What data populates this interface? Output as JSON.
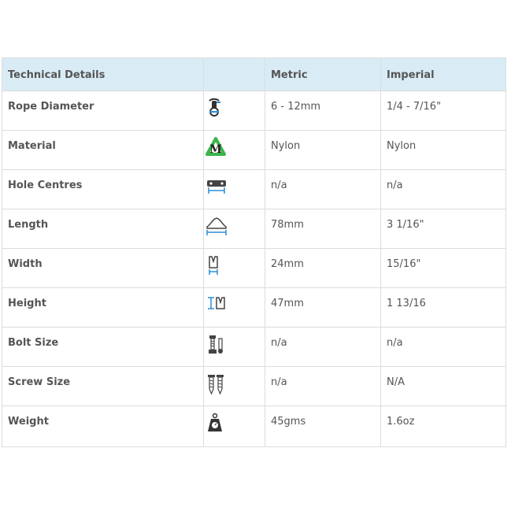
{
  "table": {
    "headers": [
      "Technical Details",
      "",
      "Metric",
      "Imperial"
    ],
    "rows": [
      {
        "label": "Rope Diameter",
        "icon": "rope-diameter-icon",
        "metric": "6 - 12mm",
        "imperial": "1/4 - 7/16\""
      },
      {
        "label": "Material",
        "icon": "nylon-recycle-icon",
        "metric": "Nylon",
        "imperial": "Nylon"
      },
      {
        "label": "Hole Centres",
        "icon": "hole-centres-icon",
        "metric": "n/a",
        "imperial": "n/a"
      },
      {
        "label": "Length",
        "icon": "length-icon",
        "metric": "78mm",
        "imperial": "3 1/16\""
      },
      {
        "label": "Width",
        "icon": "width-icon",
        "metric": "24mm",
        "imperial": "15/16\""
      },
      {
        "label": "Height",
        "icon": "height-icon",
        "metric": "47mm",
        "imperial": "1 13/16"
      },
      {
        "label": "Bolt Size",
        "icon": "bolt-icon",
        "metric": "n/a",
        "imperial": "n/a"
      },
      {
        "label": "Screw Size",
        "icon": "screw-icon",
        "metric": "n/a",
        "imperial": "N/A"
      },
      {
        "label": "Weight",
        "icon": "weight-icon",
        "metric": "45gms",
        "imperial": "1.6oz"
      }
    ]
  },
  "colors": {
    "header_bg": "#d9ecf5",
    "icon_dark": "#333333",
    "icon_blue": "#2b8ed6",
    "icon_green": "#3bb54a"
  }
}
